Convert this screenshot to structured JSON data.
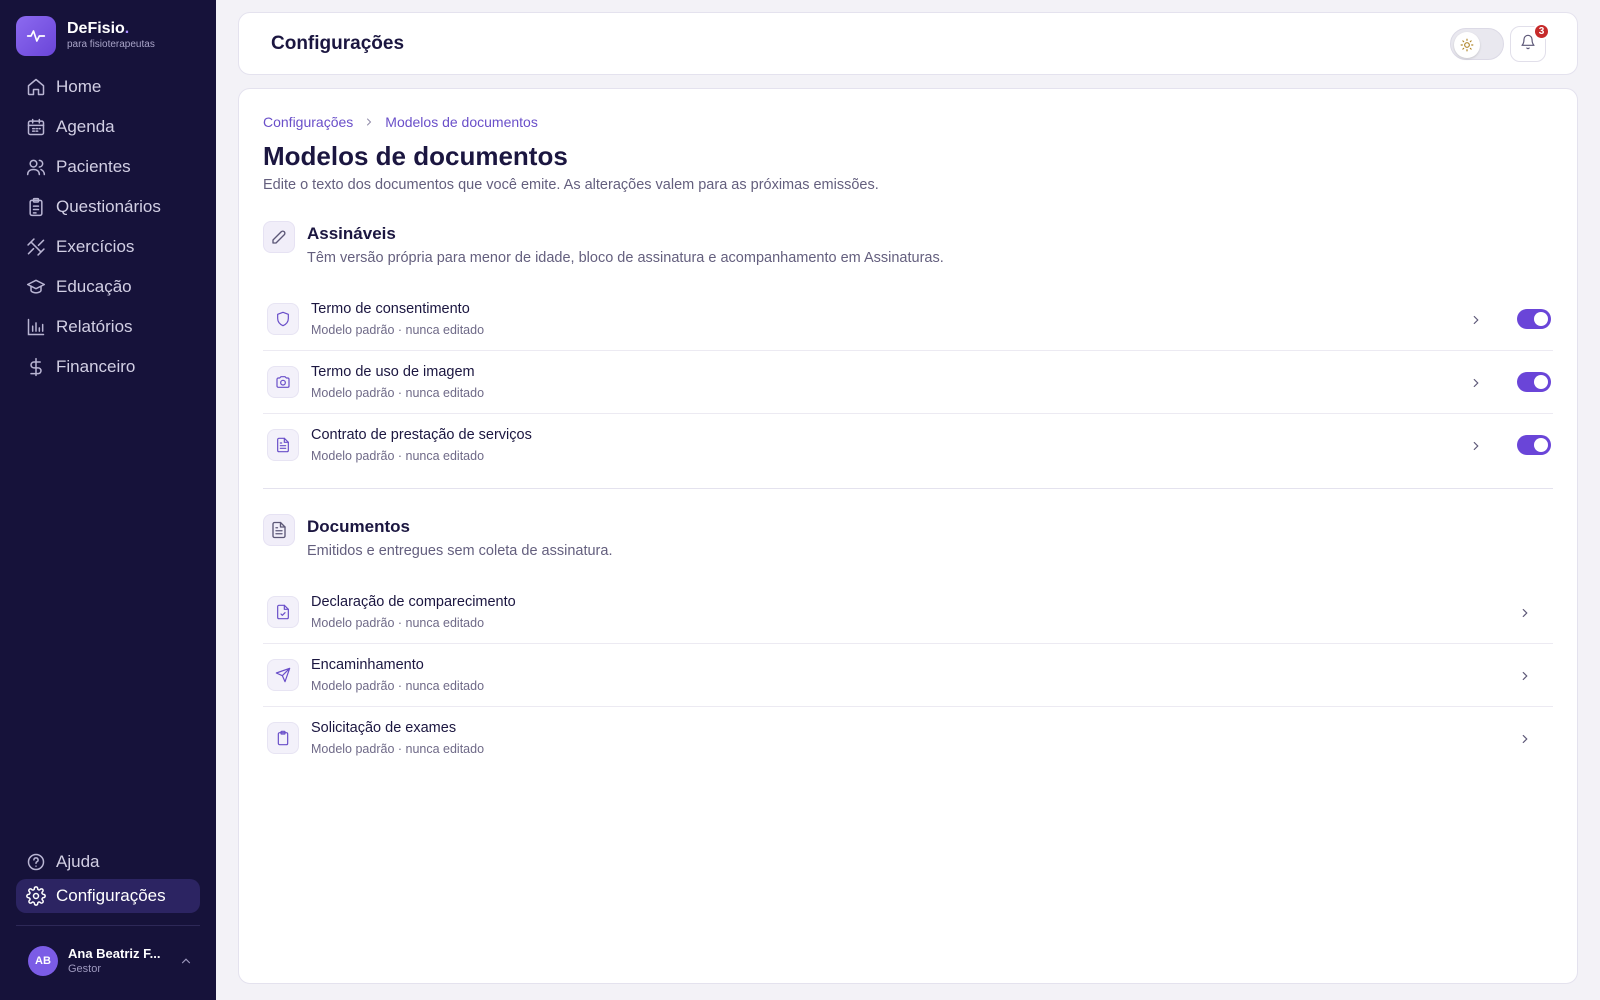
{
  "brand": {
    "name": "DeFisio",
    "dot": ".",
    "subtitle": "para fisioterapeutas"
  },
  "nav": {
    "items": [
      {
        "label": "Home",
        "icon": "home-icon"
      },
      {
        "label": "Agenda",
        "icon": "calendar-icon"
      },
      {
        "label": "Pacientes",
        "icon": "users-icon"
      },
      {
        "label": "Questionários",
        "icon": "clipboard-icon"
      },
      {
        "label": "Exercícios",
        "icon": "dumbbell-icon"
      },
      {
        "label": "Educação",
        "icon": "graduation-cap-icon"
      },
      {
        "label": "Relatórios",
        "icon": "bar-chart-icon"
      },
      {
        "label": "Financeiro",
        "icon": "dollar-icon"
      }
    ],
    "bottom": [
      {
        "label": "Ajuda",
        "icon": "help-circle-icon"
      },
      {
        "label": "Configurações",
        "icon": "gear-icon",
        "active": true
      }
    ]
  },
  "user": {
    "initials": "AB",
    "name": "Ana Beatriz F...",
    "role": "Gestor"
  },
  "header": {
    "title": "Configurações",
    "notifications_count": "3"
  },
  "breadcrumb": {
    "parent": "Configurações",
    "current": "Modelos de documentos"
  },
  "page": {
    "title": "Modelos de documentos",
    "description": "Edite o texto dos documentos que você emite. As alterações valem para as próximas emissões."
  },
  "sections": {
    "signable": {
      "title": "Assináveis",
      "description": "Têm versão própria para menor de idade, bloco de assinatura e acompanhamento em Assinaturas.",
      "items": [
        {
          "title": "Termo de consentimento",
          "subtitle": "Modelo padrão · nunca editado",
          "icon": "shield-icon",
          "enabled": true
        },
        {
          "title": "Termo de uso de imagem",
          "subtitle": "Modelo padrão · nunca editado",
          "icon": "camera-icon",
          "enabled": true
        },
        {
          "title": "Contrato de prestação de serviços",
          "subtitle": "Modelo padrão · nunca editado",
          "icon": "file-text-icon",
          "enabled": true
        }
      ]
    },
    "documents": {
      "title": "Documentos",
      "description": "Emitidos e entregues sem coleta de assinatura.",
      "items": [
        {
          "title": "Declaração de comparecimento",
          "subtitle": "Modelo padrão · nunca editado",
          "icon": "file-check-icon"
        },
        {
          "title": "Encaminhamento",
          "subtitle": "Modelo padrão · nunca editado",
          "icon": "send-icon"
        },
        {
          "title": "Solicitação de exames",
          "subtitle": "Modelo padrão · nunca editado",
          "icon": "clipboard-icon"
        }
      ]
    }
  },
  "colors": {
    "sidebar": "#16123a",
    "accent": "#6a45d8",
    "badge": "#c62a2a"
  }
}
